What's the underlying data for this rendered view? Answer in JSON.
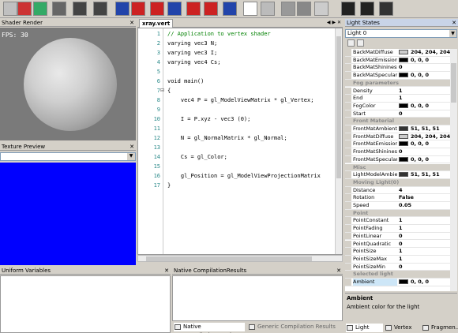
{
  "toolbar": {
    "buttons": [
      "new-icon",
      "undo-icon",
      "refresh-icon",
      "image-icon",
      "image-icon",
      "image-icon",
      "shader-icon",
      "shader-icon",
      "shader-icon",
      "shader-icon",
      "shader-icon",
      "shader-icon",
      "shader-icon",
      "plane-icon",
      "cube-icon",
      "sphere-icon",
      "teapot-icon",
      "dropper-icon",
      "fullscreen-icon",
      "fullscreen-icon",
      "gear-icon"
    ]
  },
  "shader_render": {
    "title": "Shader Render",
    "fps": "FPS: 30"
  },
  "texture_preview": {
    "title": "Texture Preview"
  },
  "editor": {
    "tab": "xray.vert",
    "lines": [
      {
        "n": "1",
        "text": "// Application to vertex shader"
      },
      {
        "n": "2",
        "text": "varying vec3 N;"
      },
      {
        "n": "3",
        "text": "varying vec3 I;"
      },
      {
        "n": "4",
        "text": "varying vec4 Cs;"
      },
      {
        "n": "5",
        "text": ""
      },
      {
        "n": "6",
        "text": "void main()"
      },
      {
        "n": "7",
        "text": "{"
      },
      {
        "n": "8",
        "text": "    vec4 P = gl_ModelViewMatrix * gl_Vertex;"
      },
      {
        "n": "9",
        "text": ""
      },
      {
        "n": "10",
        "text": "    I = P.xyz - vec3 (0);"
      },
      {
        "n": "11",
        "text": ""
      },
      {
        "n": "12",
        "text": "    N = gl_NormalMatrix * gl_Normal;"
      },
      {
        "n": "13",
        "text": ""
      },
      {
        "n": "14",
        "text": "    Cs = gl_Color;"
      },
      {
        "n": "15",
        "text": ""
      },
      {
        "n": "16",
        "text": "    gl_Position = gl_ModelViewProjectionMatrix"
      },
      {
        "n": "17",
        "text": "}"
      }
    ]
  },
  "uniform_variables": {
    "title": "Uniform Variables"
  },
  "native_compilation": {
    "title": "Native CompilationResults"
  },
  "bottom_tabs": [
    "Native CompilationResults",
    "Generic Compilation Results"
  ],
  "light_states": {
    "title": "Light States",
    "selector": "Light 0",
    "rows": [
      {
        "type": "prop",
        "name": "BackMatDiffuse",
        "swatch": "#cccccc",
        "value": "204, 204, 204"
      },
      {
        "type": "prop",
        "name": "BackMatEmission",
        "swatch": "#000000",
        "value": "0, 0, 0"
      },
      {
        "type": "prop",
        "name": "BackMatShininess",
        "swatch": "",
        "value": "0"
      },
      {
        "type": "prop",
        "name": "BackMatSpecular",
        "swatch": "#000000",
        "value": "0, 0, 0"
      },
      {
        "type": "cat",
        "name": "Fog parameters"
      },
      {
        "type": "prop",
        "name": "Density",
        "swatch": "",
        "value": "1"
      },
      {
        "type": "prop",
        "name": "End",
        "swatch": "",
        "value": "1"
      },
      {
        "type": "prop",
        "name": "FogColor",
        "swatch": "#000000",
        "value": "0, 0, 0"
      },
      {
        "type": "prop",
        "name": "Start",
        "swatch": "",
        "value": "0"
      },
      {
        "type": "cat",
        "name": "Front Material"
      },
      {
        "type": "prop",
        "name": "FrontMatAmbient",
        "swatch": "#333333",
        "value": "51, 51, 51"
      },
      {
        "type": "prop",
        "name": "FrontMatDiffuse",
        "swatch": "#cccccc",
        "value": "204, 204, 204"
      },
      {
        "type": "prop",
        "name": "FrontMatEmission",
        "swatch": "#000000",
        "value": "0, 0, 0"
      },
      {
        "type": "prop",
        "name": "FrontMatShininess",
        "swatch": "",
        "value": "0"
      },
      {
        "type": "prop",
        "name": "FrontMatSpecular",
        "swatch": "#000000",
        "value": "0, 0, 0"
      },
      {
        "type": "cat",
        "name": "Misc"
      },
      {
        "type": "prop",
        "name": "LightModelAmbient",
        "swatch": "#333333",
        "value": "51, 51, 51"
      },
      {
        "type": "cat",
        "name": "Moving Light(0)"
      },
      {
        "type": "prop",
        "name": "Distance",
        "swatch": "",
        "value": "4"
      },
      {
        "type": "prop",
        "name": "Rotation",
        "swatch": "",
        "value": "False"
      },
      {
        "type": "prop",
        "name": "Speed",
        "swatch": "",
        "value": "0.05"
      },
      {
        "type": "cat",
        "name": "Point"
      },
      {
        "type": "prop",
        "name": "PointConstant",
        "swatch": "",
        "value": "1"
      },
      {
        "type": "prop",
        "name": "PointFading",
        "swatch": "",
        "value": "1"
      },
      {
        "type": "prop",
        "name": "PointLinear",
        "swatch": "",
        "value": "0"
      },
      {
        "type": "prop",
        "name": "PointQuadratic",
        "swatch": "",
        "value": "0"
      },
      {
        "type": "prop",
        "name": "PointSize",
        "swatch": "",
        "value": "1"
      },
      {
        "type": "prop",
        "name": "PointSizeMax",
        "swatch": "",
        "value": "1"
      },
      {
        "type": "prop",
        "name": "PointSizeMin",
        "swatch": "",
        "value": "0"
      },
      {
        "type": "cat",
        "name": "Selected light"
      },
      {
        "type": "prop",
        "name": "Ambient",
        "swatch": "#000000",
        "value": "0, 0, 0",
        "selected": true
      }
    ],
    "description_title": "Ambient",
    "description_text": "Ambient color for the light",
    "tabs": [
      "Light Sta...",
      "Vertex S...",
      "Fragmen..."
    ]
  },
  "colors": {
    "texture_fill": "#0000ff",
    "render_bg": "#7a7a7a"
  }
}
